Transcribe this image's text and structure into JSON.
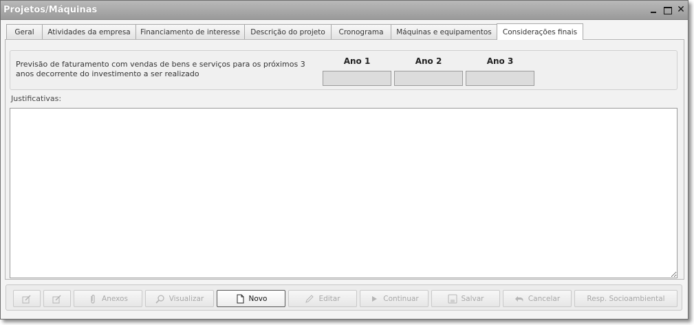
{
  "window": {
    "title": "Projetos/Máquinas",
    "close_glyph": "✕"
  },
  "tabs": [
    {
      "label": "Geral"
    },
    {
      "label": "Atividades da empresa"
    },
    {
      "label": "Financiamento de interesse"
    },
    {
      "label": "Descrição do projeto"
    },
    {
      "label": "Cronograma"
    },
    {
      "label": "Máquinas e equipamentos"
    },
    {
      "label": "Considerações finais",
      "active": true
    }
  ],
  "forecast": {
    "label": "Previsão de faturamento com vendas de bens e serviços para os próximos 3 anos decorrente do investimento a ser realizado",
    "years": [
      {
        "label": "Ano 1",
        "value": ""
      },
      {
        "label": "Ano 2",
        "value": ""
      },
      {
        "label": "Ano 3",
        "value": ""
      }
    ]
  },
  "justificativas": {
    "label": "Justificativas:",
    "value": ""
  },
  "buttons": {
    "edit_small_1_icon": "edit-icon",
    "edit_small_2_icon": "edit-icon",
    "anexos": "Anexos",
    "visualizar": "Visualizar",
    "novo": "Novo",
    "editar": "Editar",
    "continuar": "Continuar",
    "salvar": "Salvar",
    "cancelar": "Cancelar",
    "resp": "Resp. Socioambiental"
  },
  "colors": {
    "titlebar": "#a8a8a8",
    "disabled_text": "#a8a8a8",
    "enabled_text": "#111111"
  }
}
